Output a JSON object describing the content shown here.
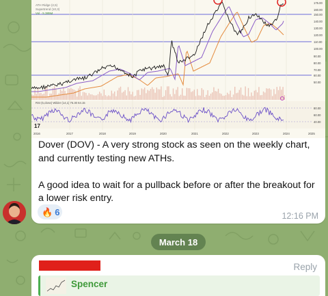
{
  "message": {
    "paragraph1": "Dover (DOV) - A very strong stock as seen on the weekly chart, and currently testing new ATHs.",
    "paragraph2": "A good idea to wait for a pullback before or after the breakout for a lower risk entry.",
    "reaction": {
      "emoji": "🔥",
      "icon": "flame-icon",
      "count": "6"
    },
    "time": "12:16 PM"
  },
  "chart": {
    "legend_line1": "ATH Ridge (2,5)",
    "legend_line2": "Supertrend (10,3)",
    "legend_line3": "Vol · 5.385M",
    "rsi_label": "RSI (5,close) Wilder (14,1)  75.30  64.15",
    "x_labels": [
      "2016",
      "2017",
      "2018",
      "2019",
      "2020",
      "2021",
      "2022",
      "2023",
      "2024",
      "2025"
    ],
    "y_labels": [
      "175.00",
      "160.00",
      "150.00",
      "140.00",
      "130.00",
      "120.00",
      "110.00",
      "100.00",
      "90.00",
      "80.00",
      "70.00",
      "60.00",
      "50.00"
    ],
    "rsi_y_labels": [
      "80.00",
      "60.00",
      "40.00"
    ]
  },
  "date_separator": "March 18",
  "reply_message": {
    "reply_label": "Reply",
    "quoted_author": "Spencer"
  },
  "colors": {
    "background": "#8fae70",
    "bubble": "#ffffff",
    "accent_blue": "#3a7bd5",
    "quote_green": "#4caf50",
    "redaction": "#e0201a"
  }
}
